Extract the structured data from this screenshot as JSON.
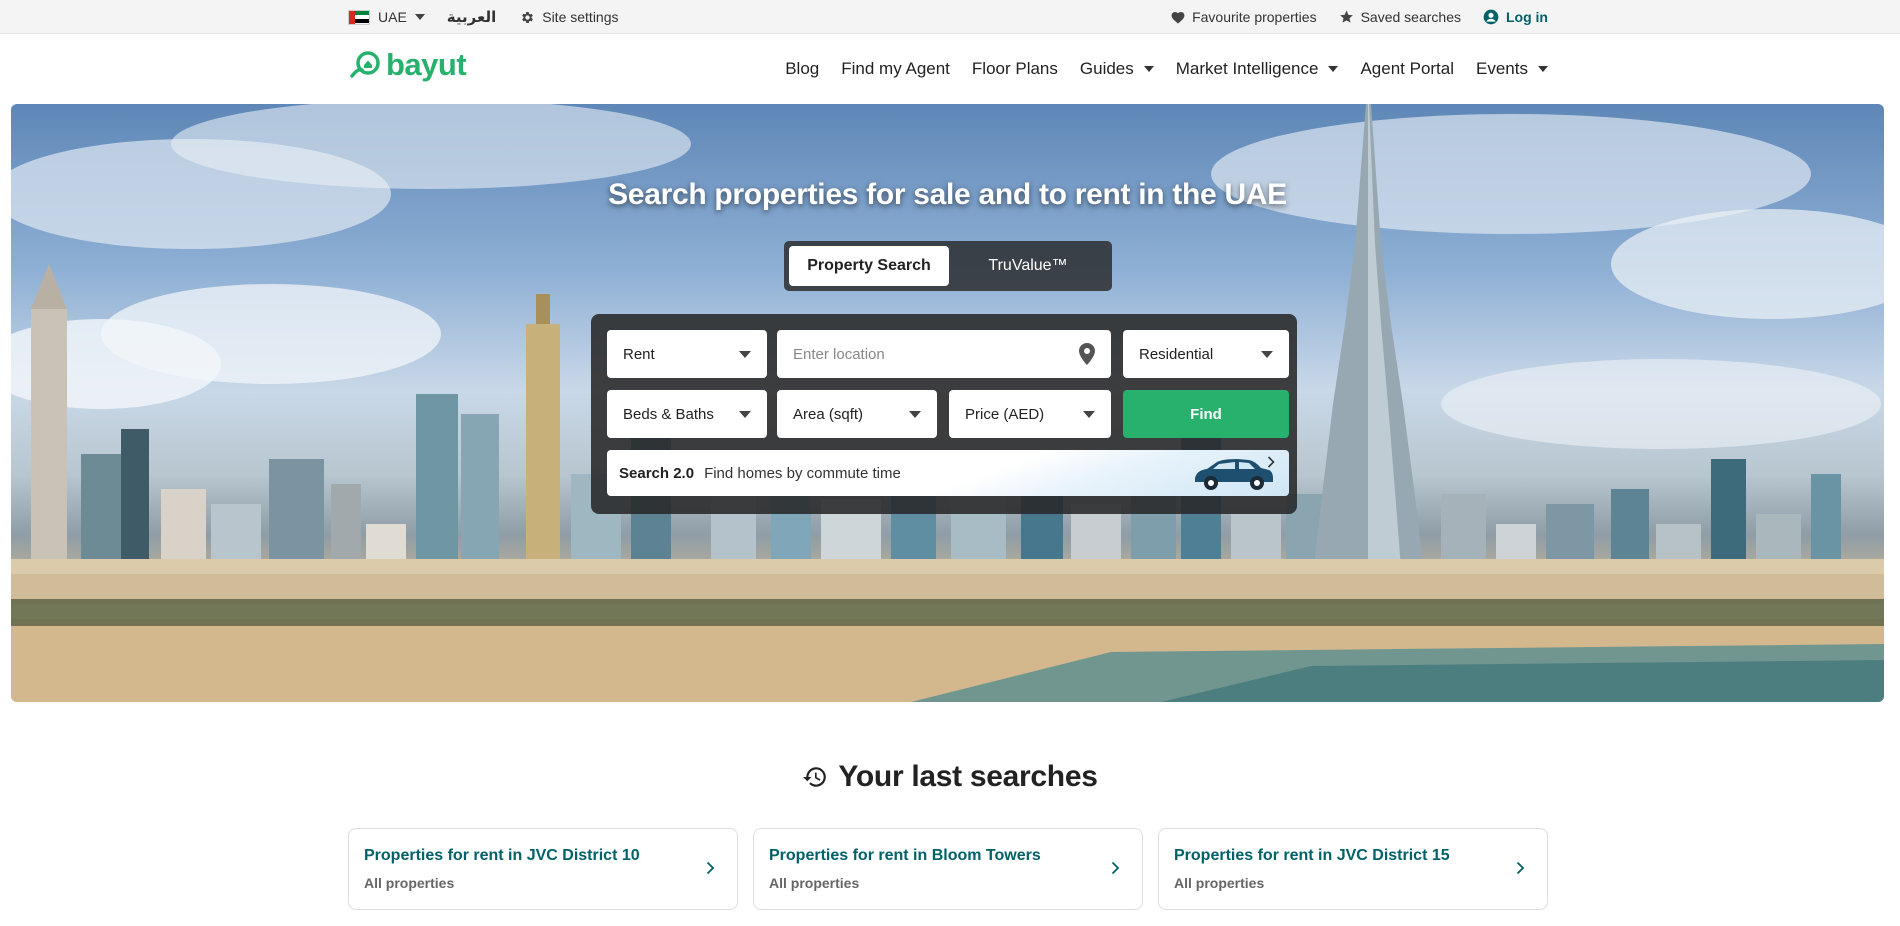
{
  "topbar": {
    "country": "UAE",
    "arabic": "العربية",
    "settings": "Site settings",
    "favourites": "Favourite properties",
    "saved": "Saved searches",
    "login": "Log in"
  },
  "header": {
    "logo": "bayut",
    "nav": [
      "Blog",
      "Find my Agent",
      "Floor Plans",
      "Guides",
      "Market Intelligence",
      "Agent Portal",
      "Events"
    ]
  },
  "hero": {
    "title": "Search properties for sale and to rent in the UAE",
    "tabs": [
      "Property Search",
      "TruValue™"
    ],
    "search": {
      "purpose": "Rent",
      "location_placeholder": "Enter location",
      "category": "Residential",
      "beds_baths": "Beds & Baths",
      "area": "Area (sqft)",
      "price": "Price (AED)",
      "find": "Find",
      "commute_badge": "Search 2.0",
      "commute_text": "Find homes by commute time"
    }
  },
  "last_searches": {
    "title": "Your last searches",
    "items": [
      {
        "title": "Properties for rent in JVC District 10",
        "subtitle": "All properties"
      },
      {
        "title": "Properties for rent in Bloom Towers",
        "subtitle": "All properties"
      },
      {
        "title": "Properties for rent in JVC District 15",
        "subtitle": "All properties"
      }
    ]
  },
  "colors": {
    "brand_green": "#28b16d",
    "link_teal": "#006169"
  }
}
